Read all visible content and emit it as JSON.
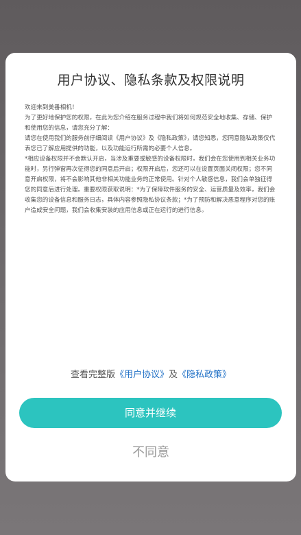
{
  "dialog": {
    "title": "用户协议、隐私条款及权限说明",
    "paragraphs": [
      "欢迎来到美番相机！",
      "为了更好地保护您的权限，在此为您介绍在服务过程中我们将如何规范安全地收集、存储、保护和使用您的信息，请您充分了解：",
      "请您在使用我们的服务前仔细阅读《用户协议》及《隐私政策》，请您知悉，您同意隐私政策仅代表您已了解应用提供的功能，以及功能运行所需的必要个人信息。",
      "*相应设备权限并不会默认开启，当涉及重要或敏感的设备权限时，我们会在您使用到相关业务功能时，另行弹窗再次征得您的同意后开启；权限开启后，您还可以在设置页面关闭权限；您不同意开启权限，将不会影响其他非相关功能业务的正常使用。针对个人敏感信息，我们会单独征得您的同意后进行处理。重要权限获取说明：*为了保障软件服务的安全、运营质量及效率，我们会收集您的设备信息和服务日志，具体内容参照隐私协议条款；*为了预防和解决恶意程序对您的账户造成安全问题，我们会收集安装的应用信息或正在运行的进行信息。"
    ],
    "full_version_prefix": "查看完整版",
    "user_agreement_link": "《用户协议》",
    "link_joiner": "及",
    "privacy_policy_link": "《隐私政策》",
    "agree_label": "同意并继续",
    "disagree_label": "不同意"
  },
  "colors": {
    "accent": "#2cc4bf",
    "link": "#1e6fc6",
    "backdrop": "#6e6a6c"
  }
}
